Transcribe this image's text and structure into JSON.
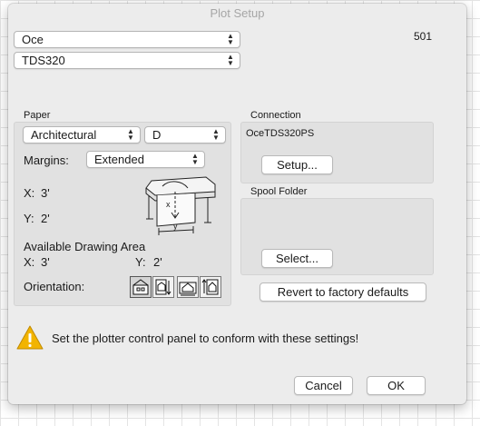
{
  "window": {
    "title": "Plot Setup",
    "id_number": "501"
  },
  "printer": {
    "manufacturer": "Oce",
    "model": "TDS320"
  },
  "paper": {
    "section_label": "Paper",
    "standard": "Architectural",
    "size": "D",
    "margins_label": "Margins:",
    "margins_value": "Extended",
    "x_label": "X:",
    "x_value": "3'",
    "y_label": "Y:",
    "y_value": "2'",
    "diagram_x_label": "x",
    "diagram_y_label": "y",
    "available_area_label": "Available Drawing Area",
    "available_x_label": "X:",
    "available_x_value": "3'",
    "available_y_label": "Y:",
    "available_y_value": "2'",
    "orientation_label": "Orientation:",
    "orientation_icons": [
      "portrait-plot-icon",
      "portrait-rotated-plot-icon",
      "landscape-plot-icon",
      "landscape-rotated-plot-icon"
    ]
  },
  "connection": {
    "section_label": "Connection",
    "name": "OceTDS320PS",
    "setup_button": "Setup..."
  },
  "spool": {
    "section_label": "Spool Folder",
    "select_button": "Select..."
  },
  "revert_button": "Revert to factory defaults",
  "warning": {
    "icon": "warning-triangle-icon",
    "message": "Set the plotter control panel to conform with these settings!",
    "color": "#f2b400"
  },
  "buttons": {
    "cancel": "Cancel",
    "ok": "OK"
  }
}
